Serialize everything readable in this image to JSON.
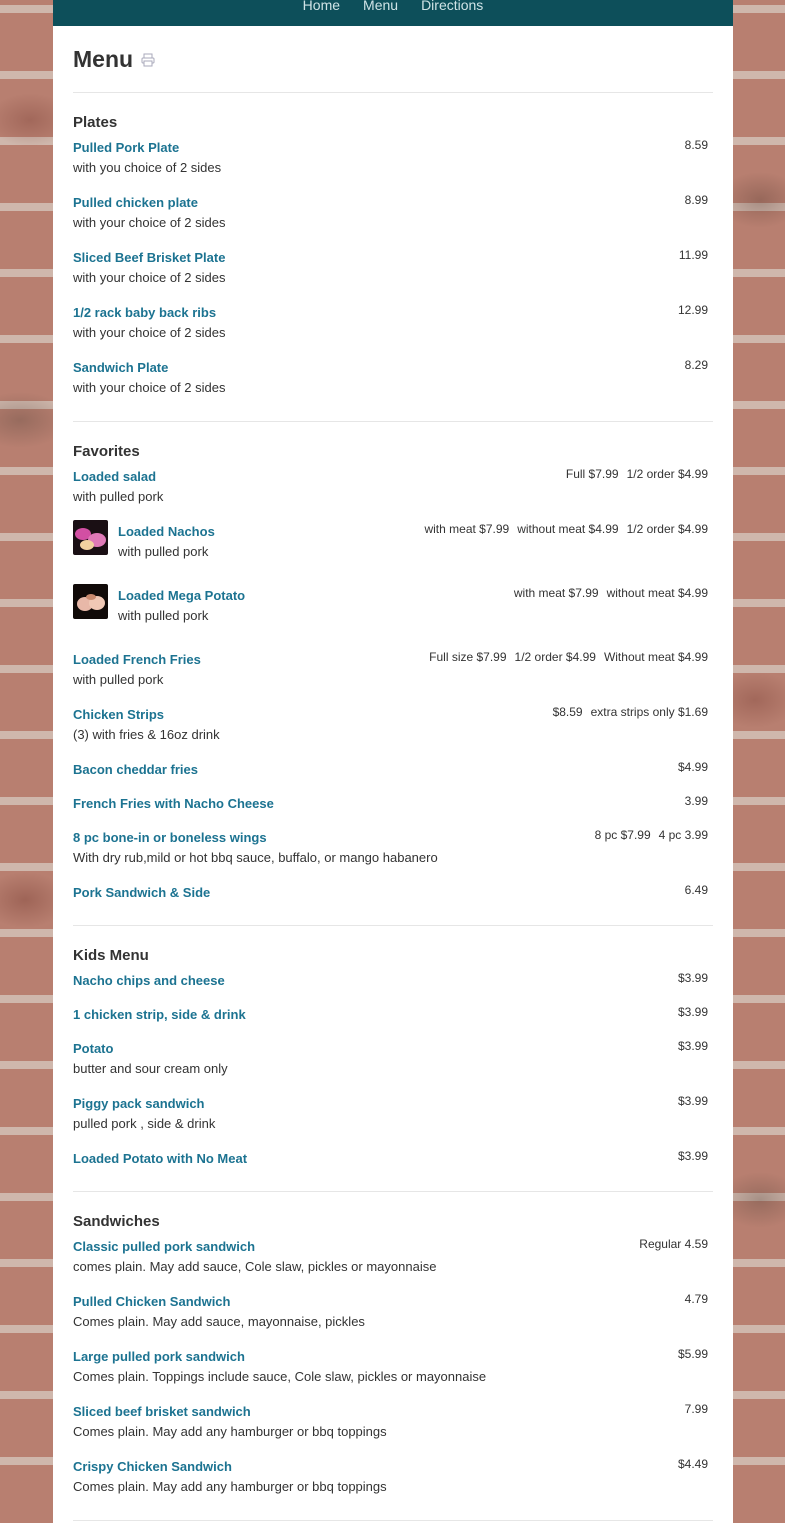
{
  "nav": {
    "home": "Home",
    "menu": "Menu",
    "directions": "Directions"
  },
  "page": {
    "title": "Menu",
    "print_icon": "printer-icon"
  },
  "sections": [
    {
      "title": "Plates",
      "items": [
        {
          "name": "Pulled Pork Plate",
          "desc": "with you choice of 2 sides",
          "prices": [
            "8.59"
          ]
        },
        {
          "name": "Pulled chicken plate",
          "desc": "with your choice of 2 sides",
          "prices": [
            "8.99"
          ]
        },
        {
          "name": "Sliced Beef Brisket Plate",
          "desc": "with your choice of 2 sides",
          "prices": [
            "11.99"
          ]
        },
        {
          "name": "1/2 rack baby back ribs",
          "desc": "with your choice of 2 sides",
          "prices": [
            "12.99"
          ]
        },
        {
          "name": "Sandwich Plate",
          "desc": "with your choice of 2 sides",
          "prices": [
            "8.29"
          ]
        }
      ]
    },
    {
      "title": "Favorites",
      "items": [
        {
          "name": "Loaded salad",
          "desc": "with pulled pork",
          "prices": [
            "Full $7.99",
            "1/2 order $4.99"
          ]
        },
        {
          "name": "Loaded Nachos",
          "desc": "with pulled pork",
          "prices": [
            "with meat $7.99",
            "without meat $4.99",
            "1/2 order $4.99"
          ],
          "thumb": "nachos"
        },
        {
          "name": "Loaded Mega Potato",
          "desc": "with pulled pork",
          "prices": [
            "with meat $7.99",
            "without meat $4.99"
          ],
          "thumb": "potato"
        },
        {
          "name": "Loaded French Fries",
          "desc": "with pulled pork",
          "prices": [
            "Full size $7.99",
            "1/2 order $4.99",
            "Without meat $4.99"
          ]
        },
        {
          "name": "Chicken Strips",
          "desc": "(3) with fries & 16oz drink",
          "prices": [
            "$8.59",
            "extra strips only  $1.69"
          ]
        },
        {
          "name": "Bacon cheddar fries",
          "desc": "",
          "prices": [
            "$4.99"
          ]
        },
        {
          "name": "French Fries with Nacho Cheese",
          "desc": "",
          "prices": [
            "3.99"
          ]
        },
        {
          "name": "8 pc bone-in or boneless wings",
          "desc": "With dry rub,mild or hot bbq sauce, buffalo, or mango habanero",
          "prices": [
            "8 pc  $7.99",
            "4 pc  3.99"
          ]
        },
        {
          "name": "Pork Sandwich & Side",
          "desc": "",
          "prices": [
            "6.49"
          ]
        }
      ]
    },
    {
      "title": "Kids Menu",
      "items": [
        {
          "name": "Nacho chips and cheese",
          "desc": "",
          "prices": [
            "$3.99"
          ]
        },
        {
          "name": "1 chicken strip, side & drink",
          "desc": "",
          "prices": [
            "$3.99"
          ]
        },
        {
          "name": "Potato",
          "desc": "butter and sour cream only",
          "prices": [
            "$3.99"
          ]
        },
        {
          "name": "Piggy pack sandwich",
          "desc": "pulled pork , side & drink",
          "prices": [
            "$3.99"
          ]
        },
        {
          "name": "Loaded Potato with No Meat",
          "desc": "",
          "prices": [
            "$3.99"
          ]
        }
      ]
    },
    {
      "title": "Sandwiches",
      "items": [
        {
          "name": "Classic pulled pork sandwich",
          "desc": "comes plain. May add sauce, Cole slaw, pickles or mayonnaise",
          "prices": [
            "Regular  4.59"
          ]
        },
        {
          "name": "Pulled Chicken Sandwich",
          "desc": "Comes plain. May add sauce, mayonnaise, pickles",
          "prices": [
            "4.79"
          ]
        },
        {
          "name": "Large pulled pork sandwich",
          "desc": "Comes plain. Toppings include sauce, Cole slaw, pickles or mayonnaise",
          "prices": [
            "$5.99"
          ]
        },
        {
          "name": "Sliced beef brisket sandwich",
          "desc": "Comes plain. May add any hamburger or bbq toppings",
          "prices": [
            "7.99"
          ]
        },
        {
          "name": "Crispy Chicken Sandwich",
          "desc": "Comes plain. May add any hamburger or bbq toppings",
          "prices": [
            "$4.49"
          ]
        }
      ]
    }
  ],
  "colors": {
    "nav_bg": "#0d4f5a",
    "link": "#1c7391",
    "text": "#333333"
  }
}
